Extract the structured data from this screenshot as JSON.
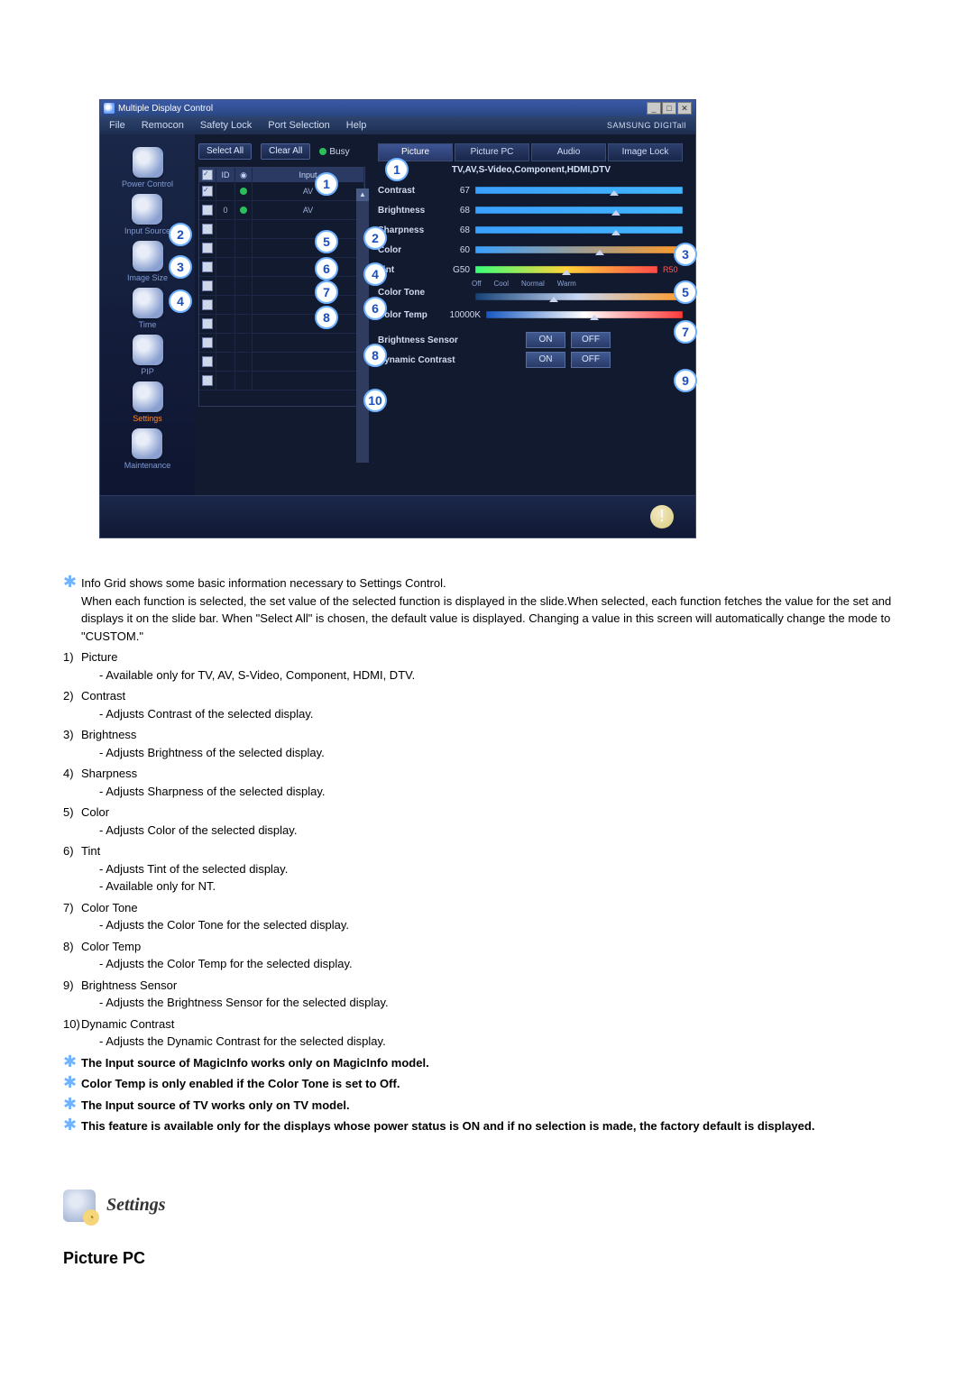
{
  "window": {
    "title": "Multiple Display Control"
  },
  "menu": {
    "file": "File",
    "remocon": "Remocon",
    "safety_lock": "Safety Lock",
    "port_selection": "Port Selection",
    "help": "Help",
    "brand": "SAMSUNG DIGITall"
  },
  "sidebar": {
    "items": [
      {
        "label": "Power Control"
      },
      {
        "label": "Input Source"
      },
      {
        "label": "Image Size"
      },
      {
        "label": "Time"
      },
      {
        "label": "PIP"
      },
      {
        "label": "Settings"
      },
      {
        "label": "Maintenance"
      }
    ]
  },
  "listpane": {
    "select_all": "Select All",
    "clear_all": "Clear All",
    "busy": "Busy",
    "headers": {
      "chk": "",
      "id": "ID",
      "status": "",
      "input": "Input"
    },
    "rows": [
      {
        "checked": true,
        "id": "",
        "status": "#2bbf5a",
        "input": "AV"
      },
      {
        "checked": false,
        "id": "0",
        "status": "#2bbf5a",
        "input": "AV"
      },
      {
        "checked": false,
        "id": "",
        "status": "",
        "input": ""
      },
      {
        "checked": false,
        "id": "",
        "status": "",
        "input": ""
      },
      {
        "checked": false,
        "id": "",
        "status": "",
        "input": ""
      },
      {
        "checked": false,
        "id": "",
        "status": "",
        "input": ""
      },
      {
        "checked": false,
        "id": "",
        "status": "",
        "input": ""
      },
      {
        "checked": false,
        "id": "",
        "status": "",
        "input": ""
      },
      {
        "checked": false,
        "id": "",
        "status": "",
        "input": ""
      },
      {
        "checked": false,
        "id": "",
        "status": "",
        "input": ""
      },
      {
        "checked": false,
        "id": "",
        "status": "",
        "input": ""
      }
    ]
  },
  "tabs": {
    "picture": "Picture",
    "picture_pc": "Picture PC",
    "audio": "Audio",
    "image_lock": "Image Lock",
    "note": "TV,AV,S-Video,Component,HDMI,DTV"
  },
  "sliders": {
    "contrast": {
      "label": "Contrast",
      "val": "67",
      "pos": 67
    },
    "brightness": {
      "label": "Brightness",
      "val": "68",
      "pos": 68
    },
    "sharpness": {
      "label": "Sharpness",
      "val": "68",
      "pos": 68
    },
    "color": {
      "label": "Color",
      "val": "60",
      "pos": 60
    },
    "tint": {
      "label": "Tint",
      "val": "G50",
      "rval": "R50",
      "pos": 50
    },
    "color_tone": {
      "label": "Color Tone",
      "pos": 38,
      "opts": {
        "off": "Off",
        "cool": "Cool",
        "normal": "Normal",
        "warm": "Warm"
      }
    },
    "color_temp": {
      "label": "Color Temp",
      "val": "10000K",
      "pos": 55
    },
    "b_sensor": {
      "label": "Brightness Sensor",
      "on": "ON",
      "off": "OFF"
    },
    "dyn_cont": {
      "label": "Dynamic Contrast",
      "on": "ON",
      "off": "OFF"
    }
  },
  "callouts": {
    "list": [
      "1",
      "2",
      "3",
      "4",
      "5",
      "6",
      "7",
      "8",
      "9",
      "10",
      "1",
      "2",
      "3",
      "4",
      "5",
      "6",
      "7",
      "8",
      "9"
    ]
  },
  "notes": {
    "intro": "Info Grid shows some basic information necessary to Settings Control.",
    "intro2": "When each function is selected, the set value of the selected function is displayed in the slide.When selected, each function fetches the value for the set and displays it on the slide bar. When \"Select All\" is chosen, the default value is displayed. Changing a value in this screen will automatically change the mode to \"CUSTOM.\"",
    "n1t": "Picture",
    "n1s": "- Available only for TV, AV, S-Video, Component, HDMI, DTV.",
    "n2t": "Contrast",
    "n2s": "- Adjusts Contrast of the selected display.",
    "n3t": "Brightness",
    "n3s": "- Adjusts Brightness of the selected display.",
    "n4t": "Sharpness",
    "n4s": "- Adjusts Sharpness of the selected display.",
    "n5t": "Color",
    "n5s": "- Adjusts Color of the selected display.",
    "n6t": "Tint",
    "n6s1": "- Adjusts Tint of the selected display.",
    "n6s2": "- Available  only for NT.",
    "n7t": "Color Tone",
    "n7s": "- Adjusts the Color Tone for the selected display.",
    "n8t": "Color Temp",
    "n8s": "- Adjusts the Color Temp for the selected display.",
    "n9t": "Brightness Sensor",
    "n9s": "- Adjusts the Brightness Sensor for the selected display.",
    "n10t": "Dynamic Contrast",
    "n10s": "- Adjusts the Dynamic Contrast for the selected display.",
    "s1": "The Input source of MagicInfo works only on MagicInfo model.",
    "s2": "Color Temp is only enabled if the Color Tone is set to Off.",
    "s3": "The Input source of TV works only on TV model.",
    "s4": "This feature is available only for the displays whose power status is ON and if no selection is made, the factory default is displayed."
  },
  "footer": {
    "settings": "Settings",
    "picture_pc": "Picture PC"
  }
}
